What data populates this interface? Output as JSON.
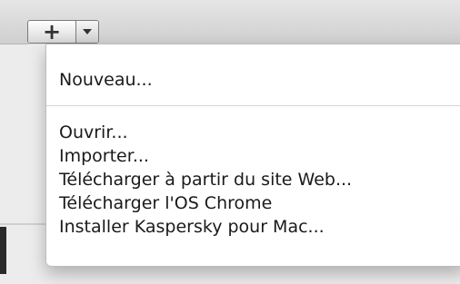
{
  "toolbar": {
    "add_button_label": "+",
    "dropdown_icon": "chevron-down-icon"
  },
  "menu": {
    "items": [
      {
        "label": "Nouveau..."
      },
      {
        "label": "Ouvrir..."
      },
      {
        "label": "Importer..."
      },
      {
        "label": "Télécharger à partir du site Web..."
      },
      {
        "label": "Télécharger l'OS Chrome"
      },
      {
        "label": "Installer Kaspersky pour Mac..."
      }
    ]
  }
}
